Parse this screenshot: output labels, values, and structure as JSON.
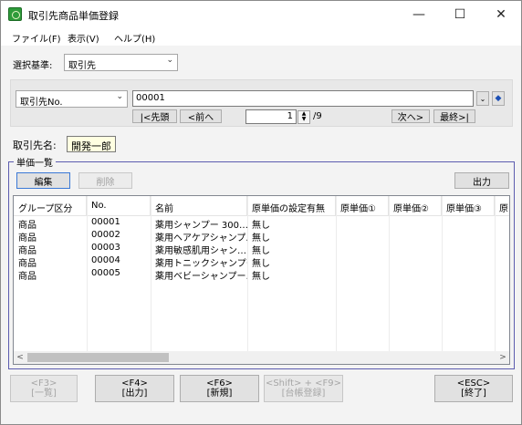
{
  "window": {
    "title": "取引先商品単価登録",
    "minimize": "—",
    "maximize": "☐",
    "close": "✕"
  },
  "menu": [
    "ファイル(F)",
    "表示(V)",
    "ヘルプ(H)"
  ],
  "selection": {
    "label": "選択基準:",
    "value": "取引先"
  },
  "search": {
    "field_combo": "取引先No.",
    "code_value": "00001",
    "first_button": "|<先頭",
    "prev_button": "<前へ",
    "page_current": "1",
    "page_total": "/9",
    "next_button": "次へ>",
    "last_button": "最終>|"
  },
  "client": {
    "label": "取引先名:",
    "name": "開発一郎"
  },
  "unit_price": {
    "group_title": "単価一覧",
    "edit_button": "編集",
    "delete_button": "削除",
    "output_button": "出力",
    "columns": [
      "グループ区分",
      "No.",
      "名前",
      "原単価の設定有無",
      "原単価①",
      "原単価②",
      "原単価③",
      "原"
    ],
    "rows": [
      [
        "商品",
        "00001",
        "薬用シャンプー 300…",
        "無し"
      ],
      [
        "商品",
        "00002",
        "薬用ヘアケアシャンプ…",
        "無し"
      ],
      [
        "商品",
        "00003",
        "薬用敏感肌用シャン…",
        "無し"
      ],
      [
        "商品",
        "00004",
        "薬用トニックシャンプー…",
        "無し"
      ],
      [
        "商品",
        "00005",
        "薬用ベビーシャンプー…",
        "無し"
      ]
    ]
  },
  "function_keys": [
    {
      "key": "<F3>",
      "label": "[一覧]",
      "enabled": false
    },
    {
      "key": "<F4>",
      "label": "[出力]",
      "enabled": true
    },
    {
      "key": "<F6>",
      "label": "[新規]",
      "enabled": true
    },
    {
      "key": "<Shift> + <F9>",
      "label": "[台帳登録]",
      "enabled": false
    },
    {
      "key": "<ESC>",
      "label": "[終了]",
      "enabled": true
    }
  ],
  "colors": {
    "accent": "#3b79d6",
    "groupbox_border": "#5c5caf",
    "name_bg": "#ffffe1"
  }
}
